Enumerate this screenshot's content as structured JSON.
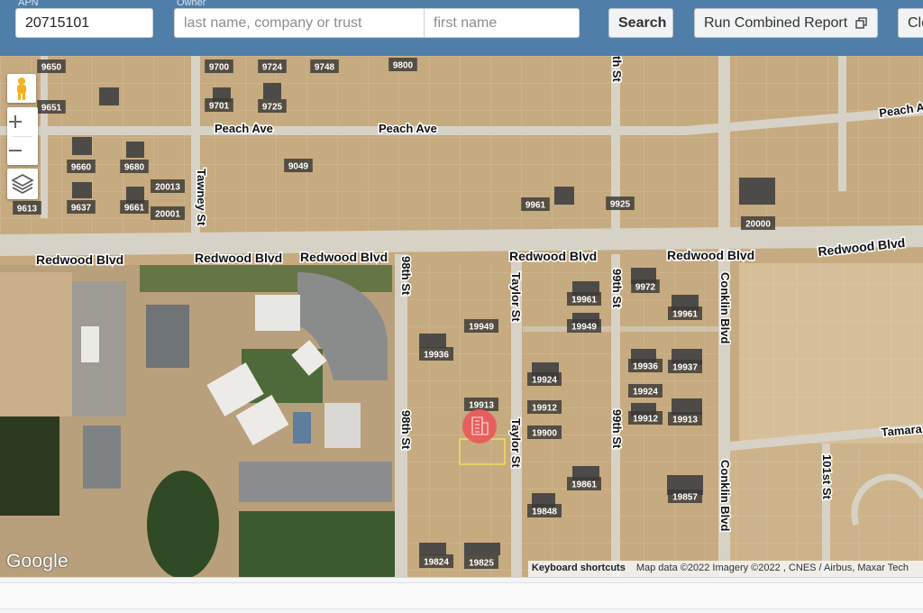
{
  "search": {
    "apn_label": "APN",
    "apn_value": "20715101",
    "owner_label": "Owner",
    "last_name_placeholder": "last name, company or trust",
    "first_name_placeholder": "first name",
    "search_button": "Search",
    "combined_report_button": "Run Combined Report",
    "clear_button": "Clear"
  },
  "map": {
    "streets": {
      "peach_ave_1": "Peach Ave",
      "peach_ave_2": "Peach Ave",
      "peach_ave_3": "Peach Ave",
      "redwood_1": "Redwood Blvd",
      "redwood_2": "Redwood Blvd",
      "redwood_3": "Redwood Blvd",
      "redwood_4": "Redwood Blvd",
      "redwood_5": "Redwood Blvd",
      "redwood_6": "Redwood Blvd",
      "tawney": "Tawney St",
      "st_98_1": "98th St",
      "st_98_2": "98th St",
      "taylor_1": "Taylor St",
      "taylor_2": "Taylor St",
      "st_99_top": "th St",
      "st_99_1": "99th St",
      "st_99_2": "99th St",
      "conklin_1": "Conklin Blvd",
      "conklin_2": "Conklin Blvd",
      "tamarack": "Tamara",
      "st_101": "101st St"
    },
    "parcels": [
      "9650",
      "9700",
      "9724",
      "9748",
      "9800",
      "9651",
      "9701",
      "9725",
      "9660",
      "9680",
      "20013",
      "9049",
      "9613",
      "9637",
      "9661",
      "20001",
      "9961",
      "9925",
      "20000",
      "9972",
      "19961",
      "19949",
      "19961",
      "19949",
      "19936",
      "19936",
      "19937",
      "19924",
      "19924",
      "19913",
      "19912",
      "19912",
      "19913",
      "19900",
      "19861",
      "19857",
      "19848",
      "19824",
      "19825"
    ],
    "marker_icon": "building-marker-icon",
    "google_logo": "Google",
    "attribution": {
      "shortcuts": "Keyboard shortcuts",
      "data": "Map data ©2022 Imagery ©2022 , CNES / Airbus, Maxar Tech"
    },
    "colors": {
      "desert": "#c8ae86",
      "road": "#d7d2c6",
      "marker": "#e85a5a",
      "parcel_highlight": "#e8e35a"
    }
  }
}
